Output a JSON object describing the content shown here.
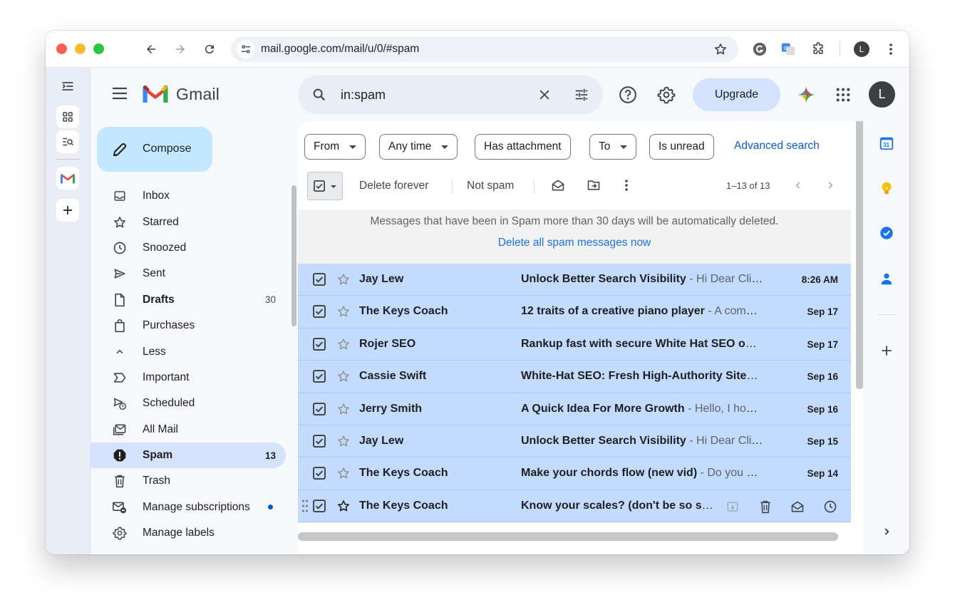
{
  "browser": {
    "url": "mail.google.com/mail/u/0/#spam",
    "profile_initial": "L"
  },
  "gmail": {
    "app_name": "Gmail",
    "search_value": "in:spam",
    "upgrade_label": "Upgrade",
    "account_initial": "L"
  },
  "sidebar": {
    "compose_label": "Compose",
    "items": [
      {
        "label": "Inbox",
        "count": "",
        "icon": "inbox-icon"
      },
      {
        "label": "Starred",
        "count": "",
        "icon": "star-icon"
      },
      {
        "label": "Snoozed",
        "count": "",
        "icon": "clock-icon"
      },
      {
        "label": "Sent",
        "count": "",
        "icon": "send-icon"
      },
      {
        "label": "Drafts",
        "count": "30",
        "icon": "draft-icon"
      },
      {
        "label": "Purchases",
        "count": "",
        "icon": "shopping-bag-icon"
      },
      {
        "label": "Less",
        "count": "",
        "icon": "chevron-up-icon"
      },
      {
        "label": "Important",
        "count": "",
        "icon": "important-icon"
      },
      {
        "label": "Scheduled",
        "count": "",
        "icon": "scheduled-send-icon"
      },
      {
        "label": "All Mail",
        "count": "",
        "icon": "all-mail-icon"
      },
      {
        "label": "Spam",
        "count": "13",
        "icon": "spam-icon"
      },
      {
        "label": "Trash",
        "count": "",
        "icon": "trash-icon"
      },
      {
        "label": "Manage subscriptions",
        "count": "",
        "icon": "unsubscribe-icon"
      },
      {
        "label": "Manage labels",
        "count": "",
        "icon": "gear-icon"
      }
    ]
  },
  "filters": {
    "from": "From",
    "any_time": "Any time",
    "has_attachment": "Has attachment",
    "to": "To",
    "is_unread": "Is unread",
    "advanced_search": "Advanced search"
  },
  "toolbar": {
    "delete_forever": "Delete forever",
    "not_spam": "Not spam",
    "pagination": "1–13 of 13"
  },
  "banner": {
    "message": "Messages that have been in Spam more than 30 days will be automatically deleted.",
    "action": "Delete all spam messages now"
  },
  "emails": [
    {
      "sender": "Jay Lew",
      "subject": "Unlock Better Search Visibility",
      "snippet": " - Hi Dear Client, I hope this message finds you well",
      "date": "8:26 AM"
    },
    {
      "sender": "The Keys Coach",
      "subject": "12 traits of a creative piano player",
      "snippet": " - A common question I get from students",
      "date": "Sep 17"
    },
    {
      "sender": "Rojer SEO",
      "subject": "Rankup fast with secure White Hat SEO on your website",
      "snippet": "",
      "date": "Sep 17"
    },
    {
      "sender": "Cassie Swift",
      "subject": "White-Hat SEO: Fresh High-Authority Sites for your brand",
      "snippet": "",
      "date": "Sep 16"
    },
    {
      "sender": "Jerry Smith",
      "subject": "A Quick Idea For More Growth",
      "snippet": " - Hello, I hope you are doing great",
      "date": "Sep 16"
    },
    {
      "sender": "Jay Lew",
      "subject": "Unlock Better Search Visibility",
      "snippet": " - Hi Dear Client, I hope this message finds you well",
      "date": "Sep 15"
    },
    {
      "sender": "The Keys Coach",
      "subject": "Make your chords flow (new vid)",
      "snippet": " - Do you ever feel stuck",
      "date": "Sep 14"
    },
    {
      "sender": "The Keys Coach",
      "subject": "Know your scales? (don't be so sure)",
      "snippet": "",
      "date": ""
    }
  ],
  "colors": {
    "selected_row": "#c2dbff",
    "compose_bg": "#c2e7ff",
    "active_nav": "#d3e3fd",
    "link_blue": "#0b57d0"
  }
}
